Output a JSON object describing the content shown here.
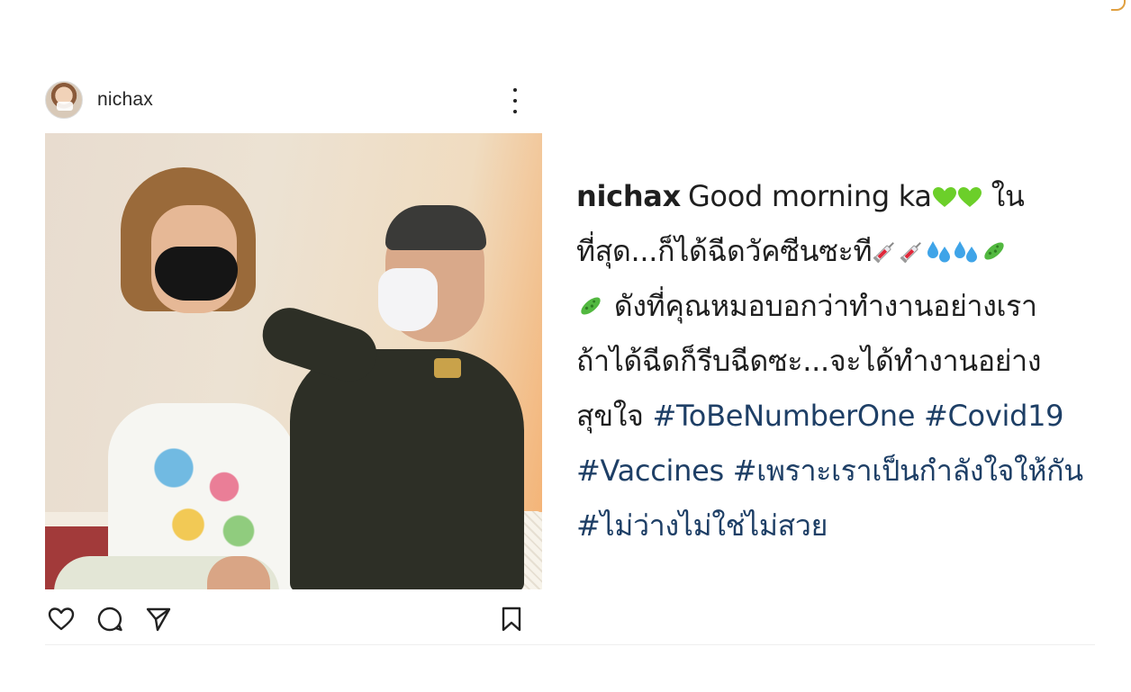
{
  "post": {
    "username": "nichax",
    "more_icon": "more-vertical-icon",
    "actions": {
      "like_icon": "heart-outline-icon",
      "comment_icon": "comment-icon",
      "share_icon": "send-icon",
      "save_icon": "bookmark-icon"
    }
  },
  "caption": {
    "username": "nichax",
    "text_1": "Good morning ka",
    "text_2": "ใน",
    "text_3": "ที่สุด...ก็ได้ฉีดวัคซีนซะที",
    "text_4": "ดังที่คุณหมอบอกว่าทำงานอย่างเรา",
    "text_5": "ถ้าได้ฉีดก็รีบฉีดซะ...จะได้ทำงานอย่าง",
    "text_6": "สุขใจ",
    "hashtags": {
      "h1": "#ToBeNumberOne",
      "h2": "#Covid19",
      "h3": "#Vaccines",
      "h4": "#เพราะเราเป็นกำลังใจให้กัน",
      "h5": "#ไม่ว่างไม่ใช่ไม่สวย"
    },
    "emoji": {
      "heart": "green-heart-icon",
      "syringe": "syringe-icon",
      "drops": "sweat-droplets-icon",
      "germ": "microbe-icon"
    }
  },
  "colors": {
    "hashtag": "#1e3f66",
    "heart": "#6ccf2a",
    "text": "#1f1f1f"
  }
}
